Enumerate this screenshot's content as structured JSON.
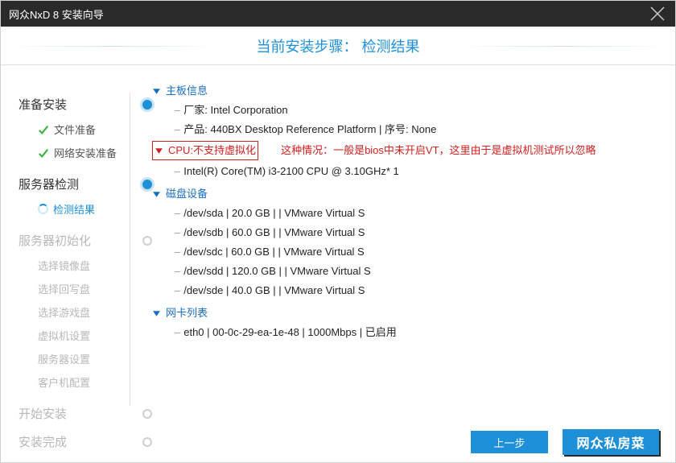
{
  "window": {
    "title": "网众NxD 8 安装向导"
  },
  "banner": {
    "prefix": "当前安装步骤：",
    "step": "检测结果"
  },
  "sidebar": {
    "prepare": {
      "title": "准备安装",
      "file_ready": "文件准备",
      "net_ready": "网络安装准备"
    },
    "server_check": {
      "title": "服务器检测",
      "result": "检测结果"
    },
    "server_init": {
      "title": "服务器初始化",
      "items": [
        "选择镜像盘",
        "选择回写盘",
        "选择游戏盘",
        "虚拟机设置",
        "服务器设置",
        "客户机配置"
      ]
    },
    "start": "开始安装",
    "done": "安装完成"
  },
  "tree": {
    "motherboard": {
      "title": "主板信息",
      "vendor_label": "厂家:",
      "vendor": "Intel Corporation",
      "product_label": "产品:",
      "product": "440BX Desktop Reference Platform",
      "serial_label": "序号:",
      "serial": "None"
    },
    "cpu": {
      "warn": "CPU:不支持虚拟化",
      "note": "这种情况：一般是bios中未开启VT，这里由于是虚拟机测试所以忽略",
      "model": "Intel(R) Core(TM) i3-2100 CPU @ 3.10GHz* 1"
    },
    "disks": {
      "title": "磁盘设备",
      "items": [
        "/dev/sda | 20.0 GB |  | VMware Virtual S",
        "/dev/sdb | 60.0 GB |  | VMware Virtual S",
        "/dev/sdc | 60.0 GB |  | VMware Virtual S",
        "/dev/sdd | 120.0 GB |  | VMware Virtual S",
        "/dev/sde | 40.0 GB |  | VMware Virtual S"
      ]
    },
    "nics": {
      "title": "网卡列表",
      "items": [
        "eth0 | 00-0c-29-ea-1e-48 | 1000Mbps | 已启用"
      ]
    }
  },
  "footer": {
    "prev": "上一步",
    "watermark": "网众私房菜"
  }
}
